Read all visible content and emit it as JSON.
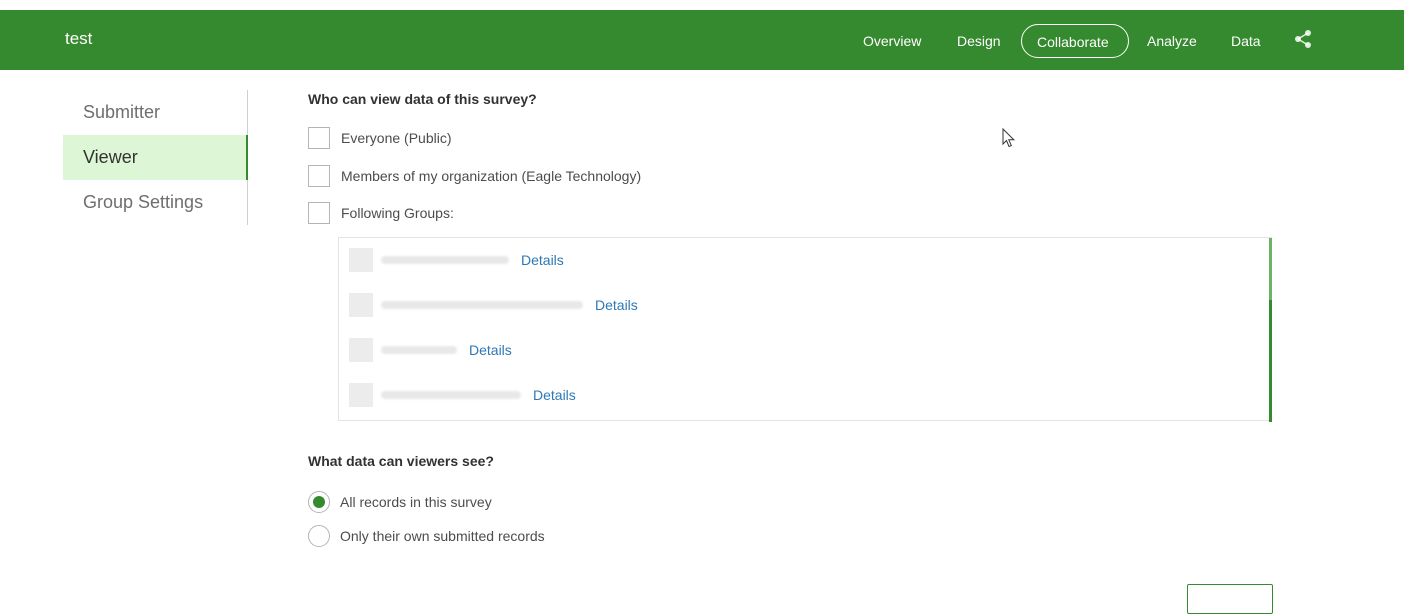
{
  "header": {
    "app_title": "test",
    "nav": [
      {
        "label": "Overview"
      },
      {
        "label": "Design"
      },
      {
        "label": "Collaborate",
        "active": true
      },
      {
        "label": "Analyze"
      },
      {
        "label": "Data"
      }
    ],
    "share_icon": "share-icon",
    "bg_color": "#35892e"
  },
  "sidebar": {
    "items": [
      {
        "label": "Submitter"
      },
      {
        "label": "Viewer",
        "active": true
      },
      {
        "label": "Group Settings"
      }
    ]
  },
  "view_section": {
    "title": "Who can view data of this survey?",
    "options": [
      {
        "label": "Everyone (Public)",
        "checked": false
      },
      {
        "label": "Members of my organization (Eagle Technology)",
        "checked": false
      },
      {
        "label": "Following Groups:",
        "checked": false
      }
    ],
    "groups": [
      {
        "details_label": "Details"
      },
      {
        "details_label": "Details"
      },
      {
        "details_label": "Details"
      },
      {
        "details_label": "Details"
      }
    ]
  },
  "data_section": {
    "title": "What data can viewers see?",
    "options": [
      {
        "label": "All records in this survey",
        "selected": true
      },
      {
        "label": "Only their own submitted records",
        "selected": false
      }
    ]
  },
  "colors": {
    "accent": "#35892e",
    "active_sidebar_bg": "#ddf7d6",
    "link": "#2e78b5"
  }
}
